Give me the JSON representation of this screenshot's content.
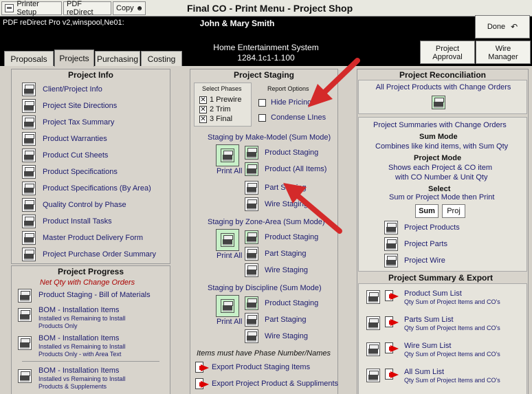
{
  "toolbar": {
    "printer_setup": "Printer Setup",
    "pdf_redirect": "PDF reDirect",
    "copy": "Copy",
    "title": "Final CO - Print Menu - Project Shop"
  },
  "header": {
    "printer": "PDF reDirect Pro v2,winspool,Ne01:",
    "client": "John & Mary Smith",
    "project_name": "Home Entertainment System",
    "project_code": "1284.1c1-1.100",
    "done": "Done",
    "project_approval": [
      "Project",
      "Approval"
    ],
    "wire_manager": [
      "Wire",
      "Manager"
    ]
  },
  "tabs": [
    {
      "label": "Proposals",
      "active": false
    },
    {
      "label": "Projects",
      "active": true
    },
    {
      "label": "Purchasing",
      "active": false
    },
    {
      "label": "Costing",
      "active": false
    }
  ],
  "project_info": {
    "title": "Project Info",
    "items": [
      "Client/Project Info",
      "Project Site Directions",
      "Project Tax Summary",
      "Product Warranties",
      "Product Cut Sheets",
      "Product Specifications",
      "Product Specifications (By Area)",
      "Quality Control by Phase",
      "Product Install Tasks",
      "Master Product Delivery Form",
      "Project Purchase Order Summary"
    ]
  },
  "project_progress": {
    "title": "Project Progress",
    "note": "Net Qty with Change Orders",
    "items": [
      {
        "label": "Product Staging - Bill of Materials",
        "sub": []
      },
      {
        "label": "BOM - Installation Items",
        "sub": [
          "Installed vs Remaining to Install",
          "Products Only"
        ]
      },
      {
        "label": "BOM - Installation Items",
        "sub": [
          "Installed vs Remaining to Install",
          "Products Only - with Area Text"
        ]
      },
      {
        "label": "BOM - Installation Items",
        "sub": [
          "Installed vs Remaining to Install",
          "Products & Supplements"
        ]
      }
    ]
  },
  "staging": {
    "title": "Project Staging",
    "select_phases": "Select Phases",
    "phases": [
      "1 Prewire",
      "2 Trim",
      "3 Final"
    ],
    "report_options": "Report Options",
    "options": [
      "Hide Pricing",
      "Condense LInes"
    ],
    "groups": [
      {
        "title": "Staging by Make-Model (Sum Mode)",
        "print_all": "Print All",
        "items": [
          "Product Staging",
          "Product (All Items)",
          "Part Staging",
          "Wire Staging"
        ]
      },
      {
        "title": "Staging by Zone-Area (Sum Mode)",
        "print_all": "Print All",
        "items": [
          "Product Staging",
          "Part Staging",
          "Wire Staging"
        ]
      },
      {
        "title": "Staging by Discipline (Sum Mode)",
        "print_all": "Print All",
        "items": [
          "Product Staging",
          "Part Staging",
          "Wire Staging"
        ]
      }
    ],
    "footer_note": "Items must have Phase Number/Names",
    "exports": [
      "Export Product Staging Items",
      "Export Project Product & Suppliments"
    ]
  },
  "reconciliation": {
    "title": "Project Reconciliation",
    "all_products": "All Project Products with Change Orders",
    "summaries_title": "Project Summaries with Change Orders",
    "sum_mode": "Sum Mode",
    "sum_mode_desc": "Combines like kind items, with Sum Qty",
    "project_mode": "Project Mode",
    "project_mode_desc": [
      "Shows each Project & CO item",
      "with CO Number & Unit Qty"
    ],
    "select": "Select",
    "select_desc": "Sum or Project Mode then Print",
    "sum_btn": "Sum",
    "proj_btn": "Proj",
    "items": [
      "Project Products",
      "Project Parts",
      "Project Wire"
    ]
  },
  "summary_export": {
    "title": "Project Summary & Export",
    "items": [
      {
        "label": "Product Sum List",
        "sub": "Qty Sum of Project Items and CO's"
      },
      {
        "label": "Parts Sum List",
        "sub": "Qty Sum of Project Items and CO's"
      },
      {
        "label": "Wire Sum List",
        "sub": "Qty Sum of Project Items and CO's"
      },
      {
        "label": "All Sum List",
        "sub": "Qty Sum of Project Items and CO's"
      }
    ]
  },
  "colors": {
    "header_bg": "#000000",
    "panel_bg": "#d8d4cc",
    "label_text": "#1a1a6e",
    "annotation_arrow": "#d42a2a"
  }
}
